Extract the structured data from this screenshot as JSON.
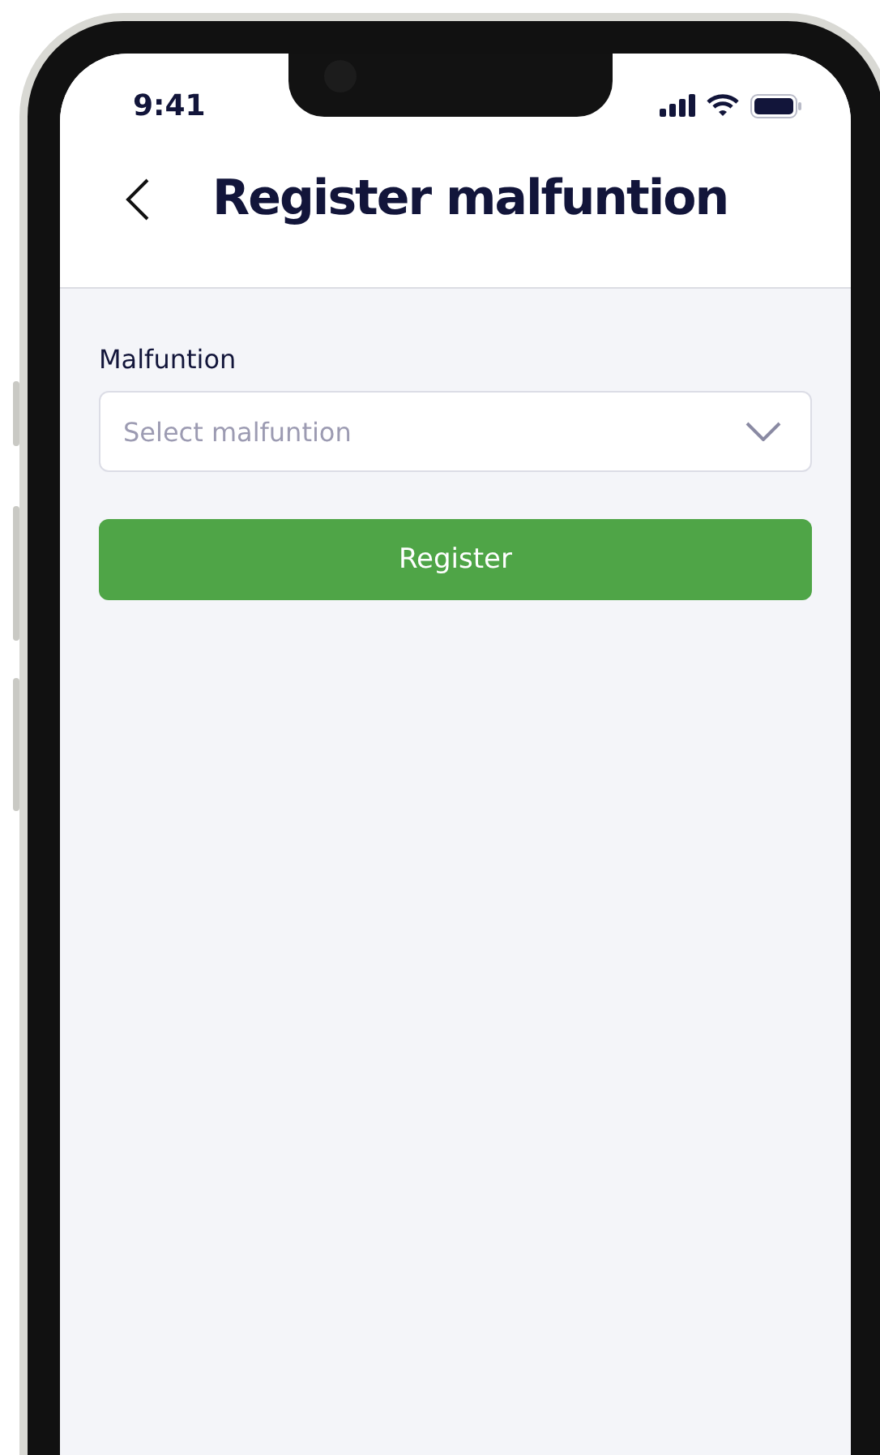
{
  "status_bar": {
    "time": "9:41"
  },
  "header": {
    "title": "Register malfuntion"
  },
  "form": {
    "field_label": "Malfuntion",
    "select": {
      "placeholder": "Select malfuntion"
    }
  },
  "buttons": [
    {
      "label": "Register"
    }
  ]
}
